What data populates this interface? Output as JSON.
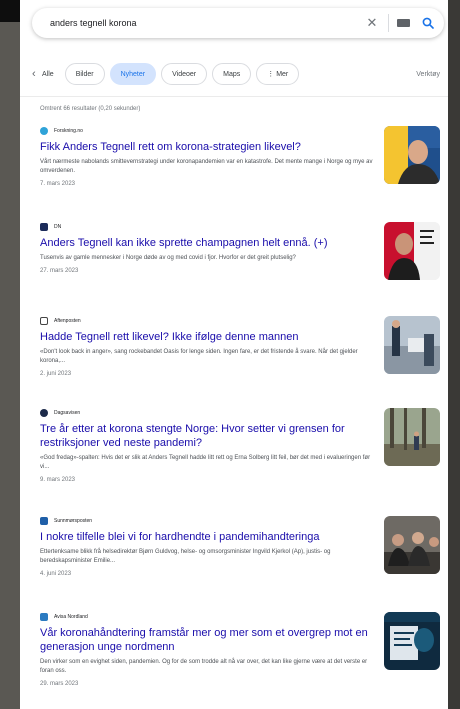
{
  "search": {
    "query": "anders tegnell korona",
    "clear_icon": "close-icon",
    "keyboard_icon": "keyboard-icon",
    "search_icon": "search-icon"
  },
  "tabs": [
    {
      "label": "Alle",
      "active": false
    },
    {
      "label": "Bilder",
      "active": false
    },
    {
      "label": "Nyheter",
      "active": true
    },
    {
      "label": "Videoer",
      "active": false
    },
    {
      "label": "Maps",
      "active": false
    },
    {
      "label": "⋮ Mer",
      "active": false
    }
  ],
  "tools_label": "Verktøy",
  "stats": "Omtrent 66 resultater (0,20 sekunder)",
  "colors": {
    "link": "#1a0dab",
    "active_tab_bg": "#d3e3fd",
    "active_tab_text": "#1a73e8"
  },
  "results": [
    {
      "source": "Forskning.no",
      "title": "Fikk Anders Tegnell rett om korona-strategien likevel?",
      "snippet": "Vårt nærmeste nabolands smittevernstrategi under koronapandemien var en katastrofe. Det mente mange i Norge og mye av omverdenen.",
      "date": "7. mars 2023"
    },
    {
      "source": "DN",
      "title": "Anders Tegnell kan ikke sprette champagnen helt ennå. (+)",
      "snippet": "Tusenvis av gamle mennesker i Norge døde av og med covid i fjor. Hvorfor er det greit plutselig?",
      "date": "27. mars 2023"
    },
    {
      "source": "Aftenposten",
      "title": "Hadde Tegnell rett likevel? Ikke ifølge denne mannen",
      "snippet": "«Don't look back in anger», sang rockebandet Oasis for lenge siden. Ingen fare, er det fristende å svare. Når det gjelder korona,...",
      "date": "2. juni 2023"
    },
    {
      "source": "Dagsavisen",
      "title": "Tre år etter at korona stengte Norge: Hvor setter vi grensen for restriksjoner ved neste pandemi?",
      "snippet": "«God fredag»-spalten: Hvis det er slik at Anders Tegnell hadde litt rett og Erna Solberg litt feil, bør det med i evalueringen før vi...",
      "date": "9. mars 2023"
    },
    {
      "source": "Sunnmørsposten",
      "title": "I nokre tilfelle blei vi for hardhendte i pandemihandteringa",
      "snippet": "Ettertenksame blikk frå helsedirektør Bjørn Guldvog, helse- og omsorgsminister Ingvild Kjerkol (Ap), justis- og beredskapsminister Emilie...",
      "date": "4. juni 2023"
    },
    {
      "source": "Avisa Nordland",
      "title": "Vår koronahåndtering framstår mer og mer som et overgrep mot en generasjon unge nordmenn",
      "snippet": "Den virker som en evighet siden, pandemien. Og for de som trodde alt nå var over, det kan like gjerne være at det verste er foran oss.",
      "date": "29. mars 2023"
    }
  ]
}
